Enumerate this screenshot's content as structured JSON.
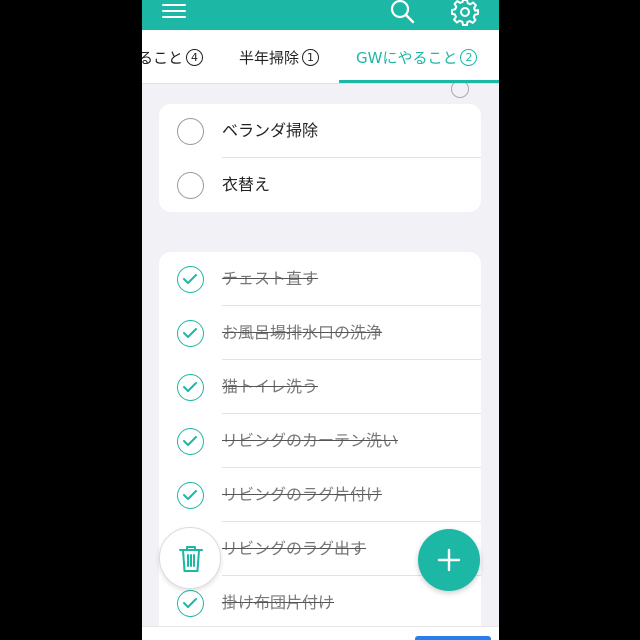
{
  "colors": {
    "accent": "#1db7a5",
    "background": "#f2f2f6",
    "done_text": "#777777"
  },
  "header": {
    "menu_icon": "hamburger-menu-icon",
    "search_icon": "search-icon",
    "settings_icon": "gear-icon"
  },
  "tabs": [
    {
      "label": "ること",
      "count": "4",
      "active": false
    },
    {
      "label": "半年掃除",
      "count": "1",
      "active": false
    },
    {
      "label": "GWにやること",
      "count": "2",
      "active": true
    }
  ],
  "pending_items": [
    {
      "label": "ベランダ掃除"
    },
    {
      "label": "衣替え"
    }
  ],
  "completed_items": [
    {
      "label": "チェスト直す"
    },
    {
      "label": "お風呂場排水口の洗浄"
    },
    {
      "label": "猫トイレ洗う"
    },
    {
      "label": "リビングのカーテン洗い"
    },
    {
      "label": "リビングのラグ片付け"
    },
    {
      "label": "リビングのラグ出す"
    },
    {
      "label": "掛け布団片付け"
    }
  ],
  "fab": {
    "delete_icon": "trash-icon",
    "add_icon": "plus-icon"
  }
}
